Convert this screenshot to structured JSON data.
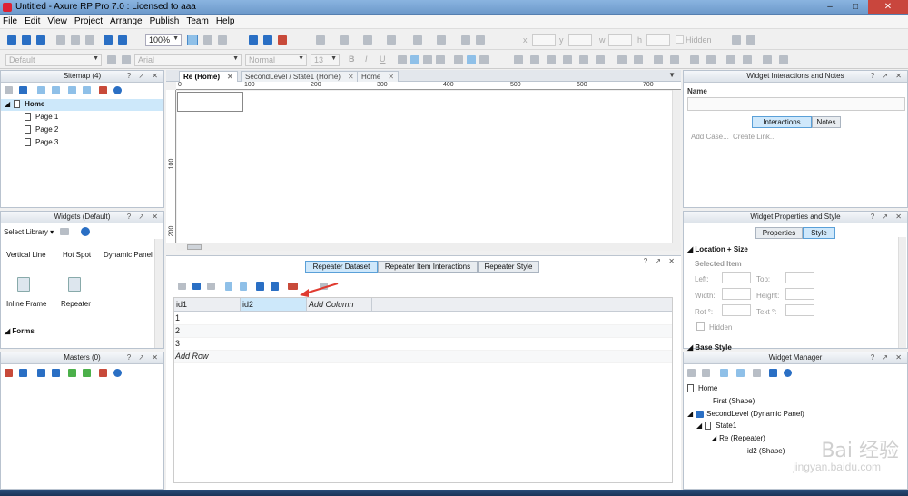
{
  "window": {
    "title": "Untitled - Axure RP Pro 7.0 : Licensed to aaa",
    "minimize": "–",
    "maximize": "□",
    "close": "✕"
  },
  "menu": [
    "File",
    "Edit",
    "View",
    "Project",
    "Arrange",
    "Publish",
    "Team",
    "Help"
  ],
  "toolbar": {
    "zoom": "100%",
    "style_combo": "Default",
    "font": "Arial",
    "weight": "Normal",
    "size": "13",
    "bold": "B",
    "italic": "I",
    "underline": "U",
    "x_label": "x",
    "y_label": "y",
    "w_label": "w",
    "h_label": "h",
    "hidden_label": "Hidden"
  },
  "sitemap": {
    "title": "Sitemap (4)",
    "controls": "? ↗ ✕",
    "items": [
      {
        "label": "Home"
      },
      {
        "label": "Page 1"
      },
      {
        "label": "Page 2"
      },
      {
        "label": "Page 3"
      }
    ]
  },
  "widgets": {
    "title": "Widgets (Default)",
    "select_library": "Select Library",
    "items": [
      "Vertical Line",
      "Hot Spot",
      "Dynamic Panel",
      "Inline Frame",
      "Repeater"
    ],
    "forms_section": "Forms"
  },
  "masters": {
    "title": "Masters (0)"
  },
  "doc_tabs": [
    {
      "label": "Re (Home)"
    },
    {
      "label": "SecondLevel / State1 (Home)"
    },
    {
      "label": "Home"
    }
  ],
  "ruler": {
    "h": [
      "0",
      "100",
      "200",
      "300",
      "400",
      "500",
      "600",
      "700"
    ],
    "v": [
      "100",
      "200"
    ]
  },
  "repeater": {
    "tabs": [
      "Repeater Dataset",
      "Repeater Item Interactions",
      "Repeater Style"
    ],
    "columns": [
      "id1",
      "id2"
    ],
    "add_column": "Add Column",
    "rows": [
      "1",
      "2",
      "3"
    ],
    "add_row": "Add Row"
  },
  "interactions_panel": {
    "title": "Widget Interactions and Notes",
    "name_label": "Name",
    "tab_interactions": "Interactions",
    "tab_notes": "Notes",
    "add_case": "Add Case...",
    "create_link": "Create Link..."
  },
  "properties_panel": {
    "title": "Widget Properties and Style",
    "tab_properties": "Properties",
    "tab_style": "Style",
    "section_location": "Location + Size",
    "selected_item": "Selected Item",
    "left": "Left:",
    "top": "Top:",
    "width": "Width:",
    "height": "Height:",
    "rot": "Rot °:",
    "text": "Text °:",
    "hidden": "Hidden",
    "section_base": "Base Style"
  },
  "widget_manager": {
    "title": "Widget Manager",
    "items": [
      "Home",
      "First (Shape)",
      "SecondLevel (Dynamic Panel)",
      "State1",
      "Re (Repeater)",
      "id2 (Shape)"
    ]
  },
  "watermark": {
    "main": "Bai 经验",
    "sub": "jingyan.baidu.com"
  },
  "colors": {
    "accent": "#2a6fc4",
    "selected": "#cde8fa",
    "close": "#c9463d",
    "arrow": "#e03a2f"
  }
}
